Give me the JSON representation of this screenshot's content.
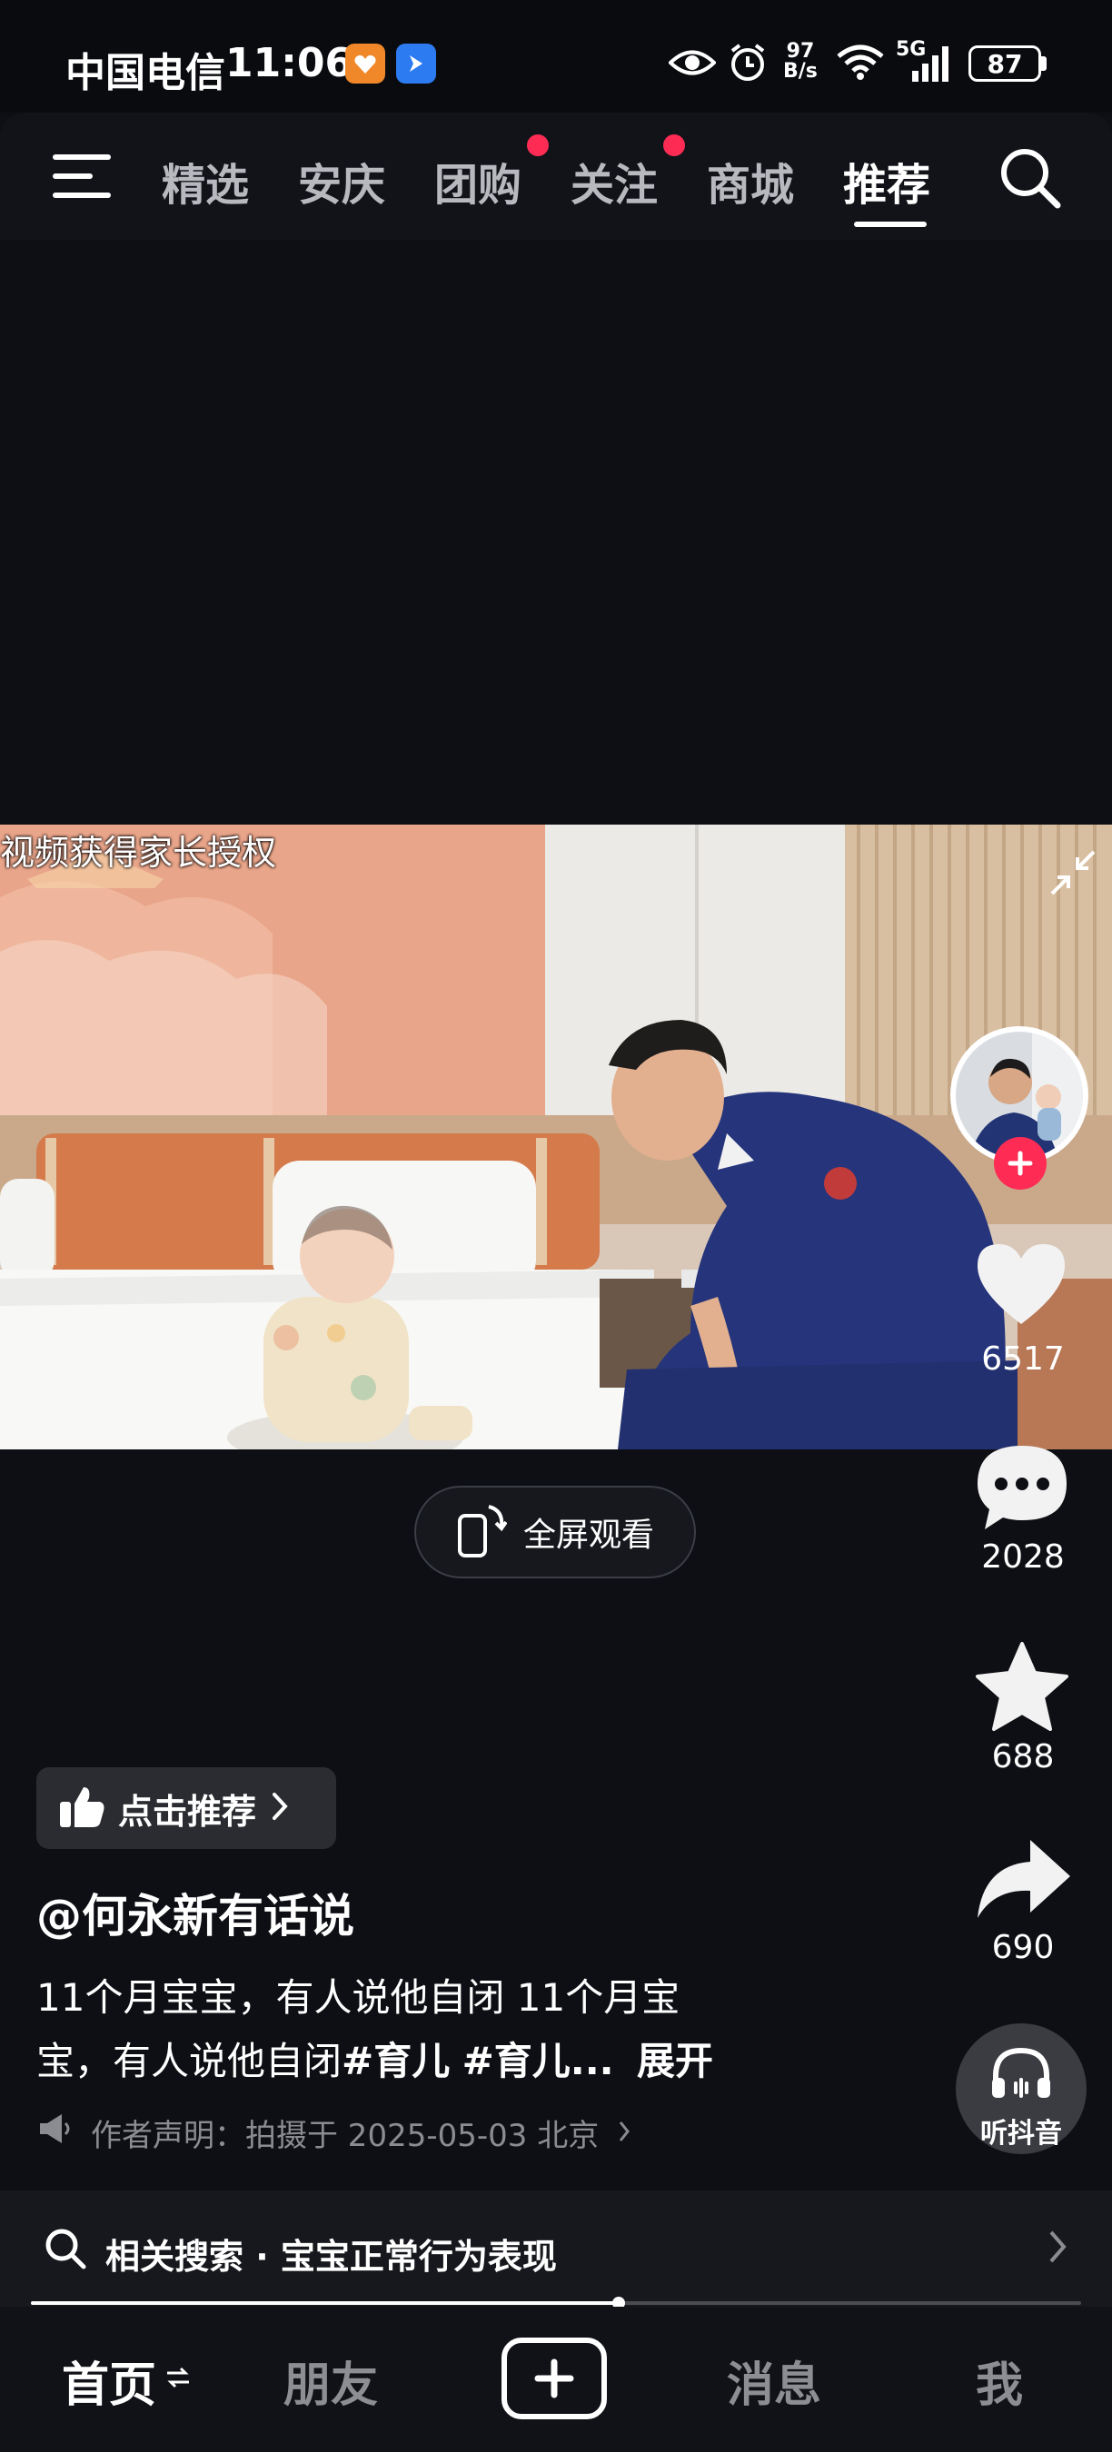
{
  "status_bar": {
    "carrier": "中国电信",
    "time": "11:06",
    "net_speed_value": "97",
    "net_speed_unit": "B/s",
    "network": "5G",
    "battery": "87"
  },
  "top_nav": {
    "tabs": [
      {
        "label": "精选"
      },
      {
        "label": "安庆"
      },
      {
        "label": "团购"
      },
      {
        "label": "关注"
      },
      {
        "label": "商城"
      },
      {
        "label": "推荐"
      }
    ],
    "active_tab": "推荐"
  },
  "video": {
    "overlay_text": "视频获得家长授权"
  },
  "fullscreen_label": "全屏观看",
  "side_rail": {
    "likes": "6517",
    "comments": "2028",
    "favorites": "688",
    "shares": "690",
    "listen_label": "听抖音"
  },
  "recommend_label": "点击推荐",
  "author": "@何永新有话说",
  "description": {
    "line1": "11个月宝宝，有人说他自闭 11个月宝",
    "line2_text": "宝，有人说他自闭",
    "tag1": "#育儿",
    "tag2": "#育儿...",
    "expand": "展开"
  },
  "statement": "作者声明：拍摄于 2025-05-03 北京",
  "related_search": {
    "prefix": "相关搜索 · ",
    "query": "宝宝正常行为表现"
  },
  "playback_progress": 0.56,
  "bottom_nav": {
    "home": "首页",
    "friends": "朋友",
    "messages": "消息",
    "me": "我"
  },
  "colors": {
    "accent_red": "#fe2c55",
    "background": "#0d0f14"
  }
}
